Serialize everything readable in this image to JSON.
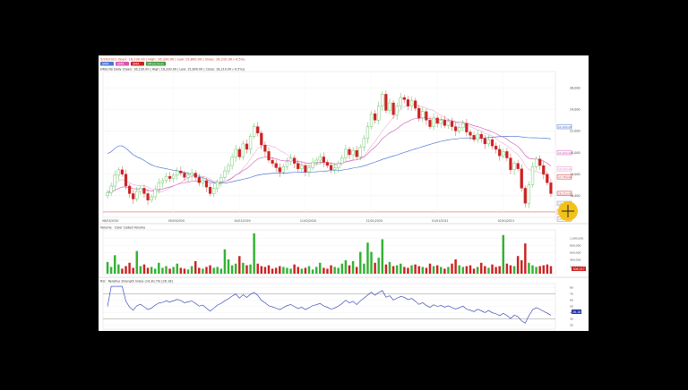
{
  "header": {
    "summary": "5/20/2021 Open: 16,230.00 | High: 16,330.00 | Low: 15,800.00 | Close: 16,210.00 (-0.5%)",
    "ma_tags": [
      "SMA",
      "EMA",
      "SMA",
      "DRSI(14,8)"
    ],
    "price_label": "DRSI.NS Daily (Open: 16,230.00 | High: 16,330.00 | Low: 15,800.00 | Close: 16,210.00 (-0.5%))"
  },
  "colors": {
    "up": "#33b233",
    "down": "#cc2222",
    "sma_long": "#3a67c8",
    "ema_short": "#d14fb0",
    "sma_short": "#e08fc4",
    "rsi_line": "#2233aa",
    "tag_blue": "#4a78d8",
    "tag_pink": "#d658b0",
    "tag_red": "#cc2222",
    "tag_green": "#3a9a3a",
    "support_line": "#e06060"
  },
  "volume_panel": {
    "label": "Volume",
    "sub_label": "Color Coded Volume"
  },
  "rsi_panel": {
    "label": "RSI",
    "sub_label": "Relative Strength Index (14,30,70) [26.18]",
    "value_tag": "26.18"
  },
  "marker": {
    "icon": "crosshair-cursor-icon"
  },
  "chart_data": [
    {
      "type": "candlestick",
      "panel": "price",
      "x_ticks": [
        "08/03/2020",
        "09/03/2020",
        "10/01/2020",
        "11/02/2020",
        "12/01/2020",
        "01/01/2021",
        "02/01/2021"
      ],
      "y_ticks": [
        "26,000",
        "24,000",
        "22,000",
        "20,000",
        "18,000",
        "16,000"
      ],
      "ylim": [
        14000,
        27500
      ],
      "support_level": 14500,
      "price_tags": [
        "22,400.00",
        "20,000.00",
        "18,500.00",
        "17,750.00",
        "16,210.00",
        "15,290.00",
        "14,500.00",
        "13,850.00"
      ],
      "close": [
        16300,
        16900,
        17900,
        18400,
        18000,
        16900,
        16200,
        15700,
        16400,
        16700,
        16200,
        15600,
        15900,
        16600,
        17200,
        17400,
        17800,
        17600,
        17900,
        18300,
        18100,
        17700,
        17900,
        18100,
        17700,
        17200,
        17400,
        16800,
        16200,
        16700,
        17300,
        17700,
        18300,
        18800,
        19600,
        20300,
        19600,
        20800,
        20300,
        21500,
        22400,
        21800,
        20700,
        20100,
        19300,
        19000,
        18600,
        18200,
        18700,
        19200,
        19500,
        19000,
        18500,
        18800,
        18200,
        18600,
        19100,
        19300,
        19600,
        19100,
        18800,
        18400,
        18600,
        19000,
        19500,
        20300,
        19800,
        20200,
        19600,
        20500,
        21300,
        22400,
        23600,
        23000,
        24300,
        25400,
        23900,
        24600,
        23500,
        24300,
        25100,
        24900,
        24300,
        24800,
        24100,
        23200,
        23800,
        23000,
        22400,
        23200,
        22700,
        23000,
        22500,
        22900,
        22400,
        22000,
        22300,
        22700,
        21900,
        21600,
        21200,
        21700,
        21300,
        20800,
        21200,
        20600,
        20300,
        19700,
        20100,
        19500,
        18400,
        19000,
        18500,
        16700,
        15300,
        17000,
        18700,
        19400,
        18800,
        18000,
        17200,
        16200
      ],
      "volume": [
        1.4,
        0.8,
        2.2,
        1.1,
        0.6,
        0.9,
        1.3,
        0.7,
        2.7,
        0.9,
        1.1,
        0.7,
        0.8,
        0.6,
        1.3,
        0.7,
        0.9,
        0.6,
        0.8,
        1.2,
        0.7,
        0.6,
        0.5,
        0.9,
        1.5,
        0.7,
        0.6,
        0.8,
        1.0,
        0.7,
        0.8,
        0.6,
        2.9,
        1.7,
        1.0,
        1.2,
        2.1,
        1.3,
        1.0,
        1.1,
        4.8,
        1.2,
        0.9,
        0.8,
        1.0,
        0.6,
        0.7,
        0.9,
        0.8,
        0.7,
        0.6,
        1.1,
        0.8,
        0.6,
        0.7,
        0.9,
        0.5,
        0.8,
        1.3,
        0.7,
        0.6,
        1.0,
        0.8,
        0.7,
        1.2,
        1.6,
        1.0,
        1.5,
        0.8,
        2.6,
        1.2,
        3.7,
        2.6,
        1.3,
        1.9,
        4.1,
        1.1,
        1.4,
        0.9,
        1.0,
        1.2,
        0.8,
        0.7,
        1.0,
        1.1,
        0.9,
        0.8,
        0.7,
        1.2,
        0.9,
        1.0,
        0.8,
        0.6,
        0.8,
        1.2,
        1.7,
        1.0,
        0.8,
        0.9,
        1.0,
        0.6,
        0.8,
        1.3,
        0.9,
        0.7,
        1.1,
        0.8,
        0.9,
        4.6,
        1.2,
        1.0,
        0.9,
        2.1,
        1.6,
        3.6,
        1.3,
        1.0,
        0.8,
        0.9,
        1.0,
        1.1,
        0.9
      ]
    },
    {
      "type": "bar",
      "panel": "volume",
      "y_ticks": [
        "1,000,000",
        "800,000",
        "600,000",
        "400,000",
        "200,000"
      ],
      "ylim": [
        0,
        5000000
      ],
      "last_value_tag": "306,517"
    },
    {
      "type": "line",
      "panel": "rsi",
      "y_ticks": [
        "80",
        "70",
        "60",
        "50",
        "40",
        "30",
        "20"
      ],
      "ylim": [
        15,
        85
      ],
      "levels": [
        70,
        30
      ]
    }
  ]
}
